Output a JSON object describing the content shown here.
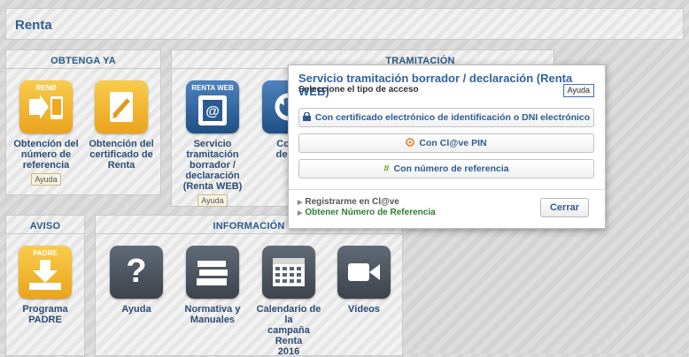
{
  "header": {
    "title": "Renta"
  },
  "obtenga": {
    "title": "OBTENGA YA",
    "tiles": [
      {
        "icon_text": "RENØ",
        "label_lines": [
          "Obtención del",
          "número de",
          "referencia"
        ],
        "help": "Ayuda"
      },
      {
        "icon_text": "",
        "label_lines": [
          "Obtención del",
          "certificado de",
          "Renta"
        ]
      }
    ]
  },
  "tramitacion": {
    "title": "TRAMITACIÓN",
    "tiles": [
      {
        "icon_text": "RENTA WEB",
        "label_lines": [
          "Servicio",
          "tramitación",
          "borrador /",
          "declaración",
          "(Renta WEB)"
        ],
        "help": "Ayuda"
      },
      {
        "label_lines": [
          "Cons",
          "devol"
        ]
      }
    ]
  },
  "aviso": {
    "title": "AVISO",
    "tiles": [
      {
        "icon_text": "PADRE",
        "label_lines": [
          "Programa",
          "PADRE"
        ]
      }
    ]
  },
  "informacion": {
    "title": "INFORMACIÓN",
    "tiles": [
      {
        "label_lines": [
          "Ayuda"
        ]
      },
      {
        "label_lines": [
          "Normativa y",
          "Manuales"
        ]
      },
      {
        "label_lines": [
          "Calendario de la",
          "campaña Renta",
          "2016"
        ]
      },
      {
        "label_lines": [
          "Vídeos"
        ]
      }
    ]
  },
  "modal": {
    "title": "Servicio tramitación borrador / declaración (Renta WEB)",
    "subtitle": "Seleccione el tipo de acceso",
    "help": "Ayuda",
    "options": [
      {
        "label": "Con certificado electrónico de identificación o DNI electrónico",
        "icon": "lock-icon"
      },
      {
        "label": "Con Cl@ve PIN",
        "icon": "clave-icon"
      },
      {
        "label": "Con número de referencia",
        "icon": "hash-icon"
      }
    ],
    "links": [
      "Registrarme en Cl@ve",
      "Obtener Número de Referencia"
    ],
    "close_label": "Cerrar"
  }
}
